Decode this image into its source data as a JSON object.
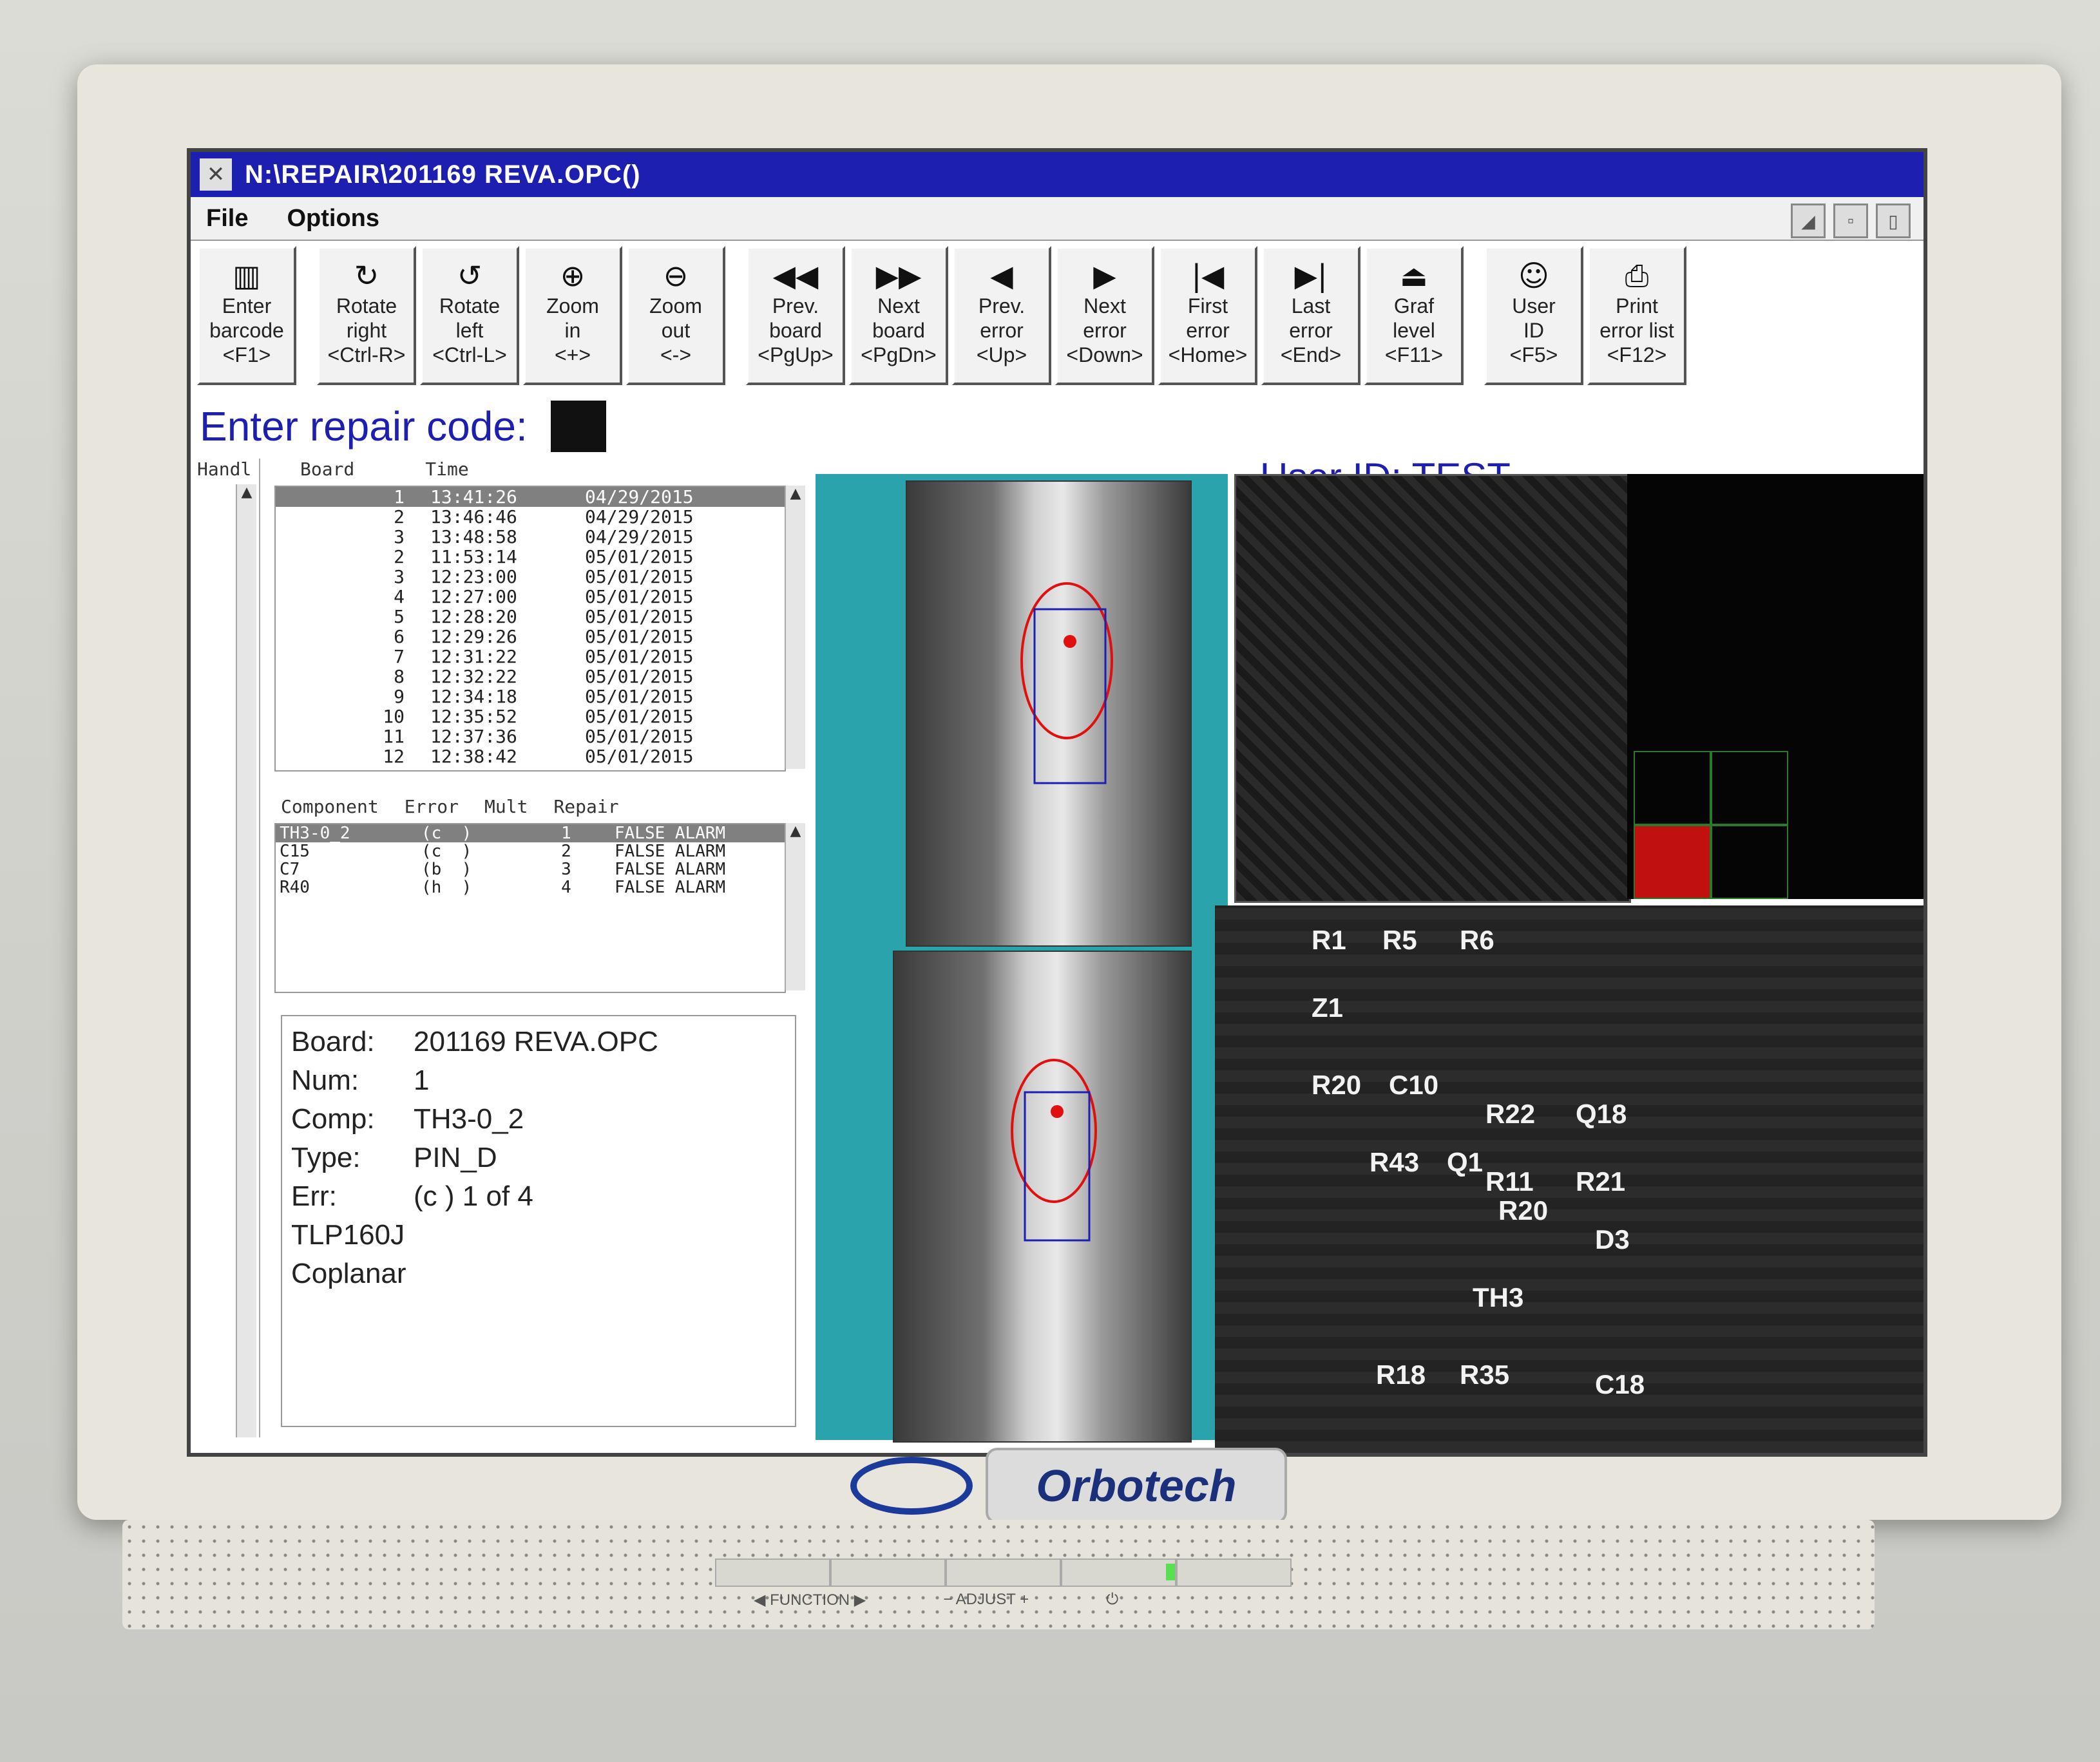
{
  "window": {
    "title": "N:\\REPAIR\\201169 REVA.OPC()"
  },
  "menu": [
    "File",
    "Options"
  ],
  "toolbar": [
    {
      "icon": "barcode-icon",
      "glyph": "▥",
      "label": "Enter\nbarcode\n<F1>"
    },
    {
      "icon": "rotate-right-icon",
      "glyph": "↻",
      "label": "Rotate\nright\n<Ctrl-R>"
    },
    {
      "icon": "rotate-left-icon",
      "glyph": "↺",
      "label": "Rotate\nleft\n<Ctrl-L>"
    },
    {
      "icon": "zoom-in-icon",
      "glyph": "⊕",
      "label": "Zoom\nin\n<+>"
    },
    {
      "icon": "zoom-out-icon",
      "glyph": "⊖",
      "label": "Zoom\nout\n<->"
    },
    {
      "icon": "prev-board-icon",
      "glyph": "◀◀",
      "label": "Prev.\nboard\n<PgUp>"
    },
    {
      "icon": "next-board-icon",
      "glyph": "▶▶",
      "label": "Next\nboard\n<PgDn>"
    },
    {
      "icon": "prev-error-icon",
      "glyph": "◀",
      "label": "Prev.\nerror\n<Up>"
    },
    {
      "icon": "next-error-icon",
      "glyph": "▶",
      "label": "Next\nerror\n<Down>"
    },
    {
      "icon": "first-error-icon",
      "glyph": "|◀",
      "label": "First\nerror\n<Home>"
    },
    {
      "icon": "last-error-icon",
      "glyph": "▶|",
      "label": "Last\nerror\n<End>"
    },
    {
      "icon": "graf-level-icon",
      "glyph": "⏏",
      "label": "Graf\nlevel\n<F11>"
    },
    {
      "icon": "user-id-icon",
      "glyph": "☺",
      "label": "User\nID\n<F5>"
    },
    {
      "icon": "print-icon",
      "glyph": "⎙",
      "label": "Print\nerror list\n<F12>"
    }
  ],
  "repair": {
    "label": "Enter repair code:"
  },
  "user": {
    "label": "User ID: TEST"
  },
  "boards": {
    "headers": {
      "handle": "Handl",
      "board": "Board",
      "time": "Time"
    },
    "rows": [
      {
        "board": "1",
        "time": "13:41:26",
        "date": "04/29/2015"
      },
      {
        "board": "2",
        "time": "13:46:46",
        "date": "04/29/2015"
      },
      {
        "board": "3",
        "time": "13:48:58",
        "date": "04/29/2015"
      },
      {
        "board": "2",
        "time": "11:53:14",
        "date": "05/01/2015"
      },
      {
        "board": "3",
        "time": "12:23:00",
        "date": "05/01/2015"
      },
      {
        "board": "4",
        "time": "12:27:00",
        "date": "05/01/2015"
      },
      {
        "board": "5",
        "time": "12:28:20",
        "date": "05/01/2015"
      },
      {
        "board": "6",
        "time": "12:29:26",
        "date": "05/01/2015"
      },
      {
        "board": "7",
        "time": "12:31:22",
        "date": "05/01/2015"
      },
      {
        "board": "8",
        "time": "12:32:22",
        "date": "05/01/2015"
      },
      {
        "board": "9",
        "time": "12:34:18",
        "date": "05/01/2015"
      },
      {
        "board": "10",
        "time": "12:35:52",
        "date": "05/01/2015"
      },
      {
        "board": "11",
        "time": "12:37:36",
        "date": "05/01/2015"
      },
      {
        "board": "12",
        "time": "12:38:42",
        "date": "05/01/2015"
      }
    ]
  },
  "components": {
    "headers": {
      "component": "Component",
      "error": "Error",
      "mult": "Mult",
      "repair": "Repair"
    },
    "rows": [
      {
        "component": "TH3-0_2",
        "error": "(c  )",
        "mult": "1",
        "repair": "FALSE ALARM"
      },
      {
        "component": "C15",
        "error": "(c  )",
        "mult": "2",
        "repair": "FALSE ALARM"
      },
      {
        "component": "C7",
        "error": "(b  )",
        "mult": "3",
        "repair": "FALSE ALARM"
      },
      {
        "component": "R40",
        "error": "(h  )",
        "mult": "4",
        "repair": "FALSE ALARM"
      }
    ]
  },
  "details": {
    "board_label": "Board:",
    "board": "201169 REVA.OPC",
    "num_label": "Num:",
    "num": "1",
    "comp_label": "Comp:",
    "comp": "TH3-0_2",
    "type_label": "Type:",
    "type": "PIN_D",
    "err_label": "Err:",
    "err": "(c   ) 1 of 4",
    "part": "TLP160J",
    "note": "Coplanar"
  },
  "pcb_labels": [
    "R1",
    "R5",
    "R6",
    "Z1",
    "R20",
    "C10",
    "R22",
    "Q18",
    "R43",
    "Q1",
    "R11",
    "R21",
    "R20",
    "D3",
    "TH3",
    "R18",
    "R35",
    "C18"
  ],
  "monitor": {
    "brand": "Orbotech",
    "function_label": "◀ FUNCTION ▶",
    "adjust_label": "−  ADJUST  +",
    "power_label": "⏻"
  }
}
